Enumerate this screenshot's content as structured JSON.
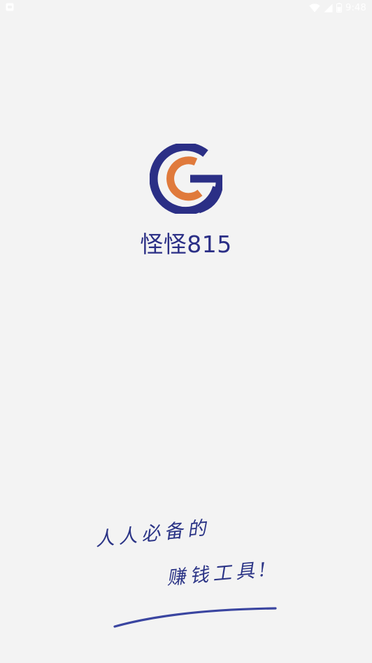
{
  "status_bar": {
    "time": "9:48",
    "icons": [
      "notification-icon",
      "wifi-icon",
      "cell-signal-icon",
      "battery-icon"
    ]
  },
  "app": {
    "name": "怪怪815",
    "logo_letters": "CG",
    "colors": {
      "brand_blue": "#2b2f86",
      "brand_orange": "#e07a3c"
    }
  },
  "slogan": {
    "line1": "人人必备的",
    "line2": "赚钱工具!"
  }
}
